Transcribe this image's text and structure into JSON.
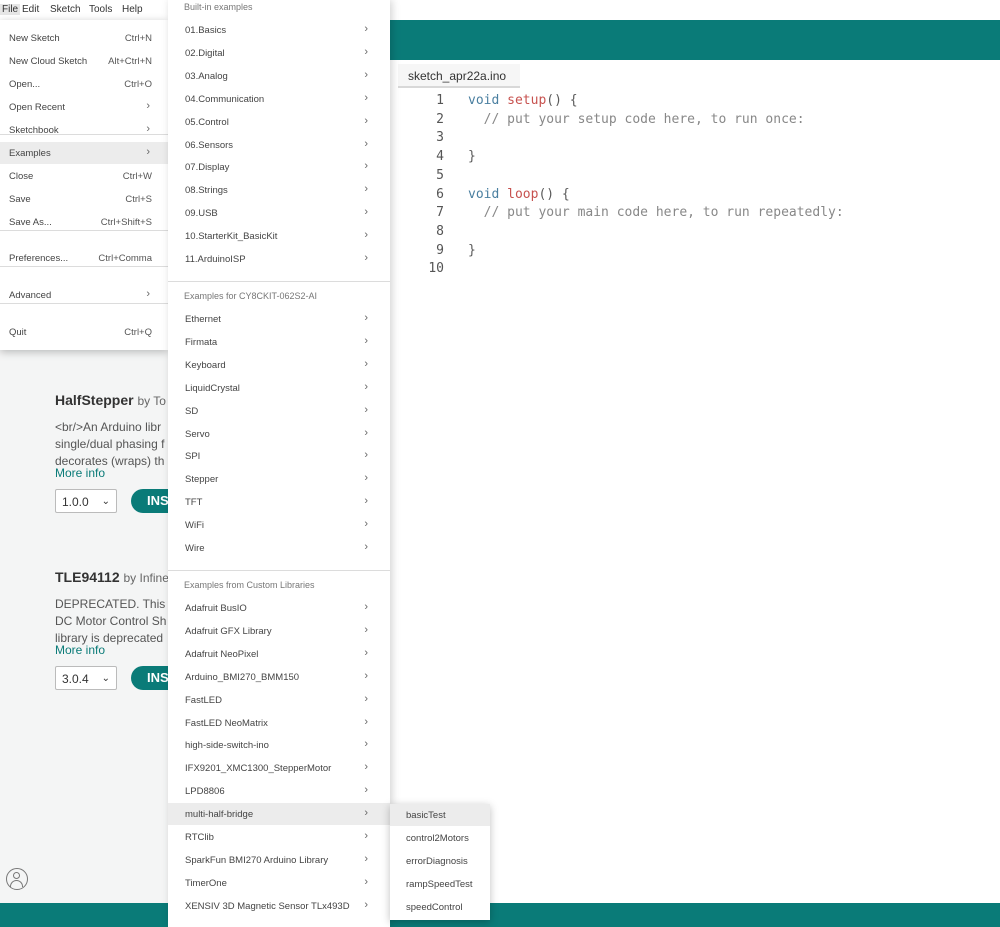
{
  "menubar": {
    "items": [
      "File",
      "Edit",
      "Sketch",
      "Tools",
      "Help"
    ]
  },
  "editor": {
    "tab": "sketch_apr22a.ino",
    "lines": [
      {
        "n": "1",
        "code": [
          {
            "t": "void ",
            "c": "kw"
          },
          {
            "t": "setup",
            "c": "kw-fn"
          },
          {
            "t": "() {",
            "c": ""
          }
        ]
      },
      {
        "n": "2",
        "code": [
          {
            "t": "  // put your setup code here, to run once:",
            "c": "cmt"
          }
        ]
      },
      {
        "n": "3",
        "code": []
      },
      {
        "n": "4",
        "code": [
          {
            "t": "}",
            "c": ""
          }
        ]
      },
      {
        "n": "5",
        "code": []
      },
      {
        "n": "6",
        "code": [
          {
            "t": "void ",
            "c": "kw"
          },
          {
            "t": "loop",
            "c": "kw-fn"
          },
          {
            "t": "() {",
            "c": ""
          }
        ]
      },
      {
        "n": "7",
        "code": [
          {
            "t": "  // put your main code here, to run repeatedly:",
            "c": "cmt"
          }
        ]
      },
      {
        "n": "8",
        "code": []
      },
      {
        "n": "9",
        "code": [
          {
            "t": "}",
            "c": ""
          }
        ]
      },
      {
        "n": "10",
        "code": []
      }
    ]
  },
  "library": {
    "items": [
      {
        "title": "HalfStepper",
        "by": "by To",
        "desc": [
          "<br/>An Arduino libr",
          "single/dual phasing f",
          "decorates (wraps) th"
        ],
        "more": "More info",
        "version": "1.0.0",
        "install": "INS"
      },
      {
        "title": "TLE94112",
        "by": "by Infine",
        "desc": [
          "DEPRECATED. This lit",
          "DC Motor Control Sh",
          "library is deprecated"
        ],
        "more": "More info",
        "version": "3.0.4",
        "install": "INS"
      }
    ]
  },
  "file_menu": {
    "items": [
      {
        "label": "New Sketch",
        "shortcut": "Ctrl+N"
      },
      {
        "label": "New Cloud Sketch",
        "shortcut": "Alt+Ctrl+N"
      },
      {
        "label": "Open...",
        "shortcut": "Ctrl+O"
      },
      {
        "label": "Open Recent",
        "submenu": true
      },
      {
        "label": "Sketchbook",
        "submenu": true
      },
      {
        "label": "Examples",
        "submenu": true,
        "active": true
      },
      {
        "label": "Close",
        "shortcut": "Ctrl+W"
      },
      {
        "label": "Save",
        "shortcut": "Ctrl+S"
      },
      {
        "label": "Save As...",
        "shortcut": "Ctrl+Shift+S"
      },
      {
        "label": "Preferences...",
        "shortcut": "Ctrl+Comma"
      },
      {
        "label": "Advanced",
        "submenu": true
      },
      {
        "label": "Quit",
        "shortcut": "Ctrl+Q"
      }
    ]
  },
  "examples_menu": {
    "sections": [
      {
        "header": "Built-in examples",
        "items": [
          "01.Basics",
          "02.Digital",
          "03.Analog",
          "04.Communication",
          "05.Control",
          "06.Sensors",
          "07.Display",
          "08.Strings",
          "09.USB",
          "10.StarterKit_BasicKit",
          "11.ArduinoISP"
        ]
      },
      {
        "header": "Examples for CY8CKIT-062S2-AI",
        "items": [
          "Ethernet",
          "Firmata",
          "Keyboard",
          "LiquidCrystal",
          "SD",
          "Servo",
          "SPI",
          "Stepper",
          "TFT",
          "WiFi",
          "Wire"
        ]
      },
      {
        "header": "Examples from Custom Libraries",
        "items": [
          "Adafruit BusIO",
          "Adafruit GFX Library",
          "Adafruit NeoPixel",
          "Arduino_BMI270_BMM150",
          "FastLED",
          "FastLED NeoMatrix",
          "high-side-switch-ino",
          "IFX9201_XMC1300_StepperMotor",
          "LPD8806",
          "multi-half-bridge",
          "RTClib",
          "SparkFun BMI270 Arduino Library",
          "TimerOne",
          "XENSIV 3D Magnetic Sensor TLx493D"
        ]
      }
    ],
    "active_item": "multi-half-bridge"
  },
  "sub_menu": {
    "items": [
      "basicTest",
      "control2Motors",
      "errorDiagnosis",
      "rampSpeedTest",
      "speedControl"
    ],
    "active_item": "basicTest"
  },
  "colors": {
    "accent": "#0a7b78",
    "menu_active": "#ececec"
  }
}
